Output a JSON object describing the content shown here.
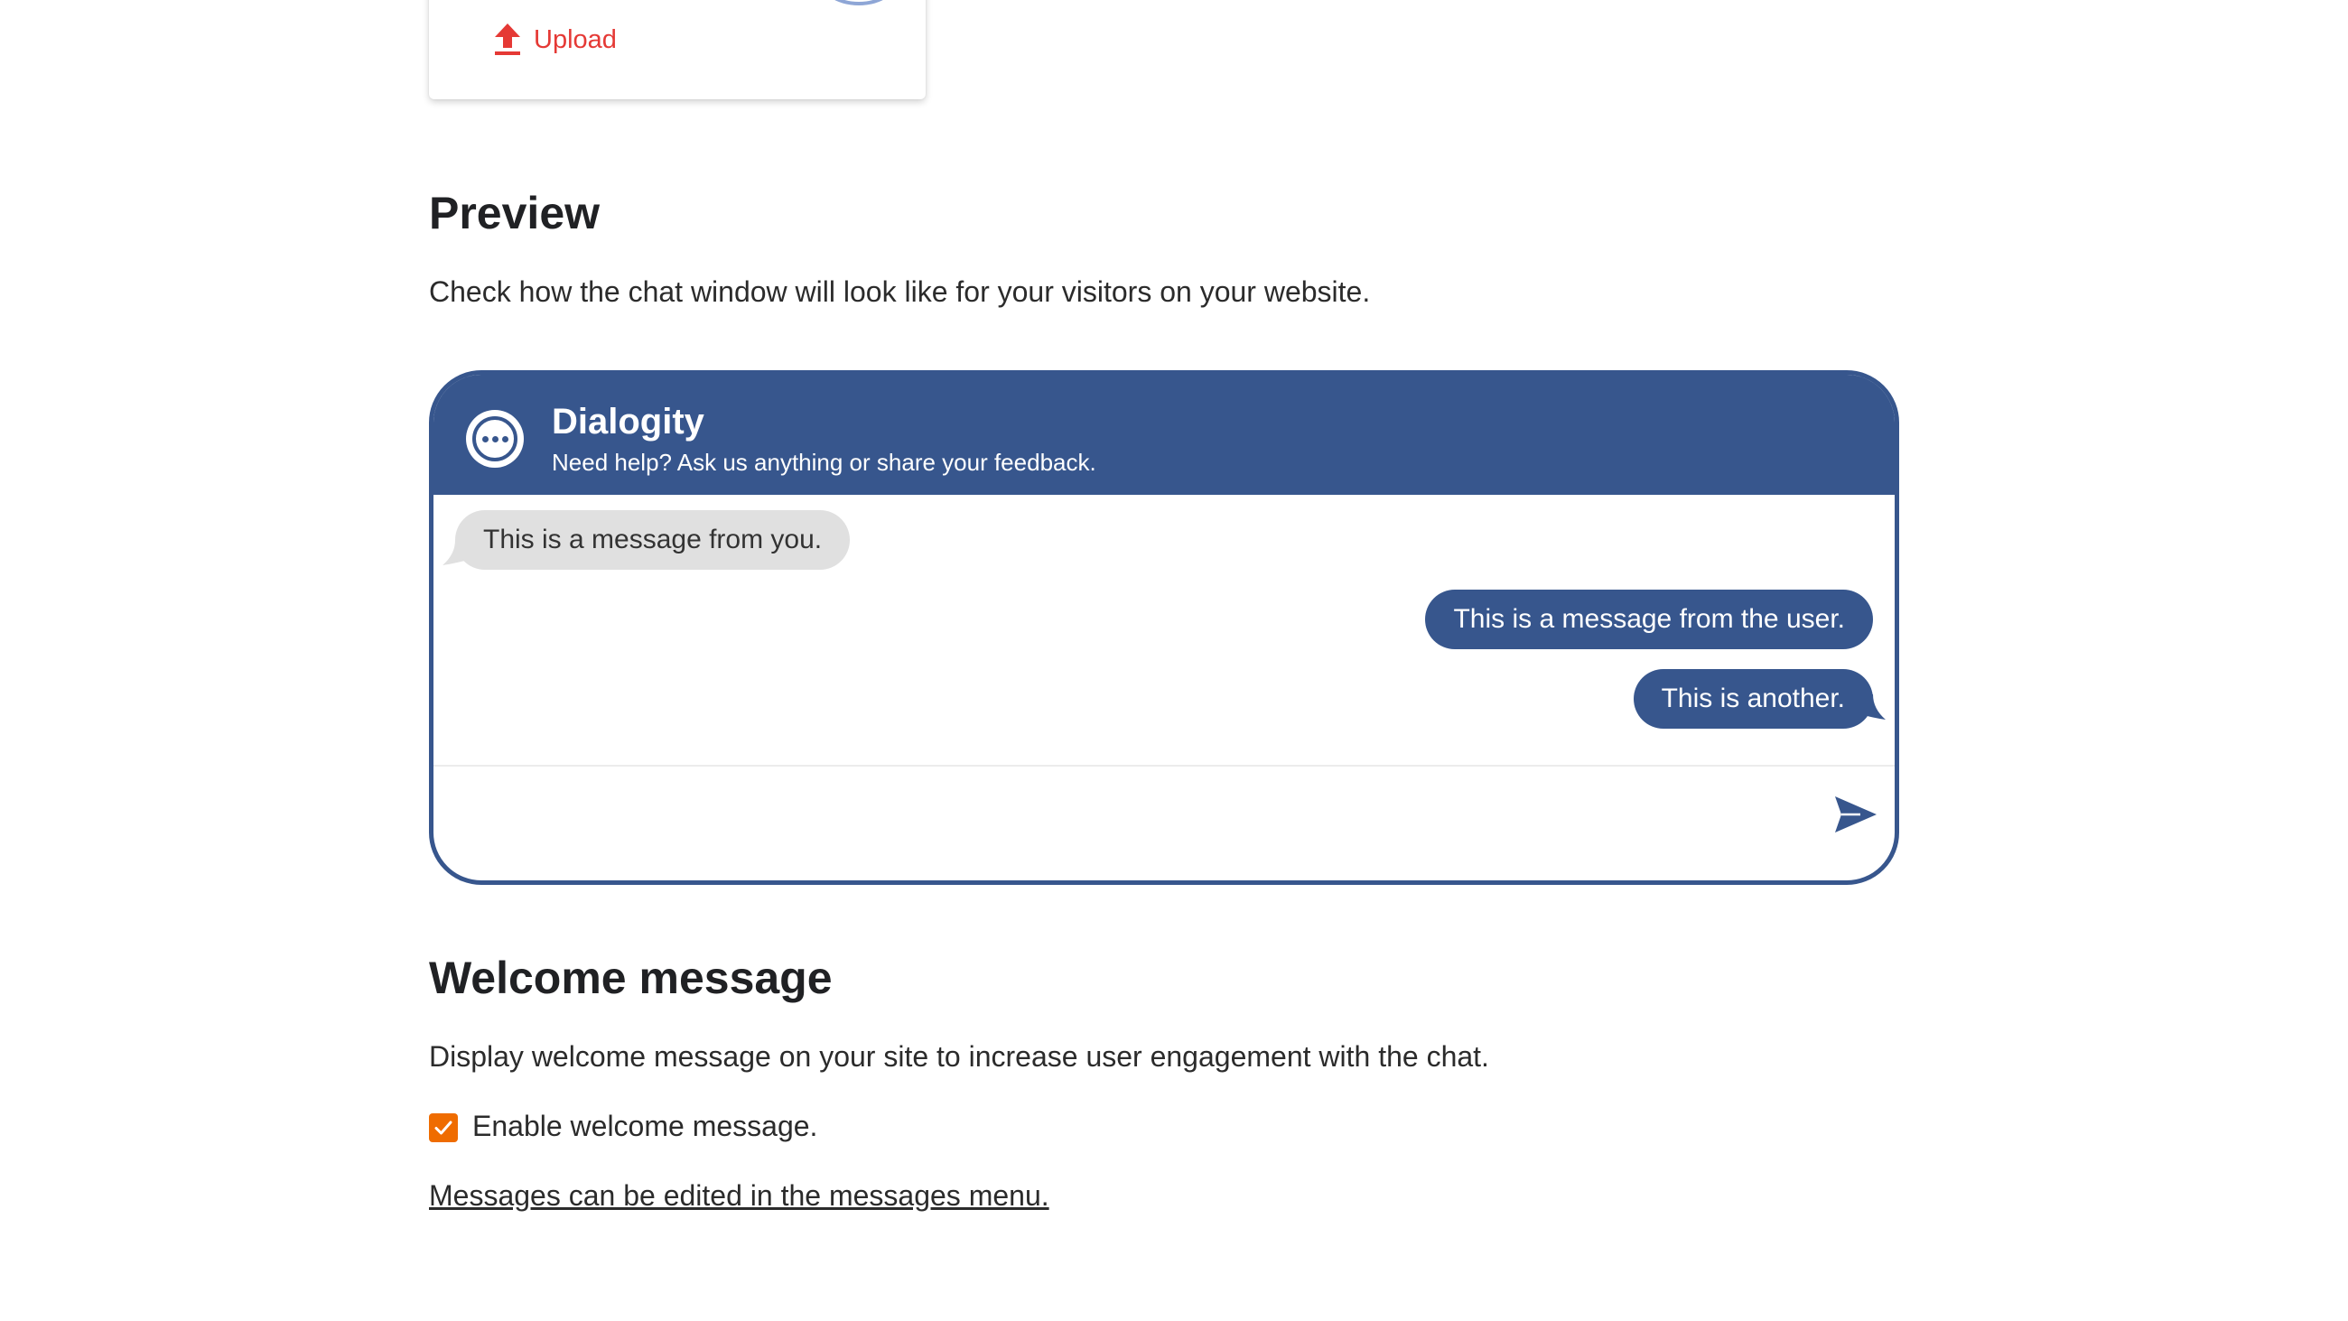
{
  "upload": {
    "label": "Upload",
    "icon": "upload-arrow-icon",
    "color": "#e53935"
  },
  "preview": {
    "title": "Preview",
    "description": "Check how the chat window will look like for your visitors on your website."
  },
  "chat": {
    "brand_color": "#37568d",
    "name": "Dialogity",
    "tagline": "Need help? Ask us anything or share your feedback.",
    "logo_icon": "chat-dots-icon",
    "messages": [
      {
        "from": "agent",
        "text": "This is a message from you."
      },
      {
        "from": "user",
        "text": "This is a message from the user."
      },
      {
        "from": "user",
        "text": "This is another."
      }
    ],
    "input_placeholder": "",
    "send_icon": "send-icon"
  },
  "welcome": {
    "title": "Welcome message",
    "description": "Display welcome message on your site to increase user engagement with the chat.",
    "checkbox_label": "Enable welcome message.",
    "checkbox_checked": true,
    "checkbox_color": "#ef6c00",
    "edit_link": "Messages can be edited in the messages menu."
  }
}
